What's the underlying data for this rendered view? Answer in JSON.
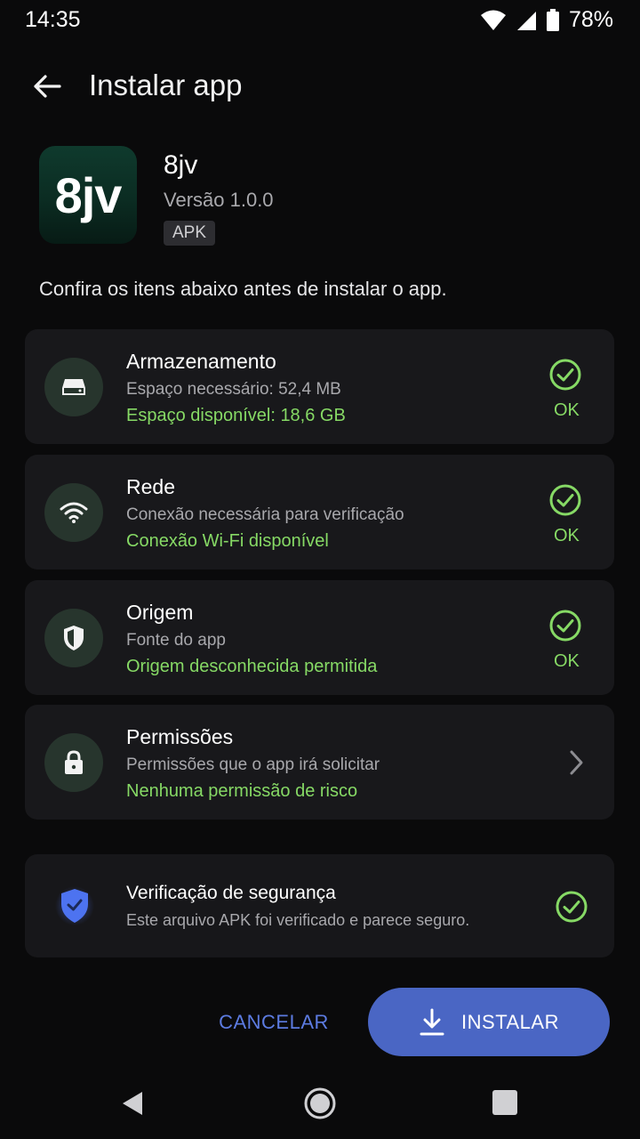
{
  "status_bar": {
    "time": "14:35",
    "battery_percent": "78%"
  },
  "app_bar": {
    "title": "Instalar app"
  },
  "app": {
    "icon_text": "8jv",
    "name": "8jv",
    "version": "Versão 1.0.0",
    "badge": "APK"
  },
  "intro": "Confira os itens abaixo antes de instalar o app.",
  "checks": [
    {
      "icon": "storage-icon",
      "title": "Armazenamento",
      "subtitle": "Espaço necessário: 52,4 MB",
      "status": "Espaço disponível: 18,6 GB",
      "result": "OK"
    },
    {
      "icon": "wifi-icon",
      "title": "Rede",
      "subtitle": "Conexão necessária para verificação",
      "status": "Conexão Wi-Fi disponível",
      "result": "OK"
    },
    {
      "icon": "shield-icon",
      "title": "Origem",
      "subtitle": "Fonte do app",
      "status": "Origem desconhecida permitida",
      "result": "OK"
    },
    {
      "icon": "lock-icon",
      "title": "Permissões",
      "subtitle": "Permissões que o app irá solicitar",
      "status": "Nenhuma permissão de risco"
    }
  ],
  "security": {
    "title": "Verificação de segurança",
    "subtitle": "Este arquivo APK foi verificado e parece seguro."
  },
  "actions": {
    "cancel": "CANCELAR",
    "install": "INSTALAR"
  },
  "colors": {
    "accent": "#4a66c4",
    "success": "#86d965",
    "background": "#0a0a0b",
    "card": "#18181b"
  }
}
